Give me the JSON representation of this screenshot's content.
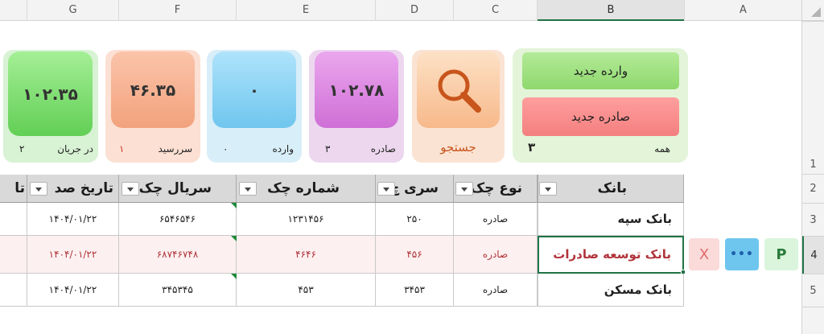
{
  "columns": [
    "G",
    "F",
    "E",
    "D",
    "C",
    "B",
    "A"
  ],
  "rows": [
    "1",
    "2",
    "3",
    "4",
    "5"
  ],
  "actions": {
    "new_incoming": "وارده جدید",
    "new_outgoing": "صادره جدید"
  },
  "all_card": {
    "label": "همه",
    "count": "۳"
  },
  "search_label": "جستجو",
  "tiles": [
    {
      "value": "۱۰۲.۷۸",
      "label": "صادره",
      "count": "۳"
    },
    {
      "value": "۰",
      "label": "وارده",
      "count": "۰"
    },
    {
      "value": "۴۶.۳۵",
      "label": "سررسید",
      "count": "۱"
    },
    {
      "value": "۱۰۲.۳۵",
      "label": "در جریان",
      "count": "۲"
    }
  ],
  "table": {
    "headers": [
      "بانک",
      "نوع چک",
      "سری چ",
      "شماره چک",
      "سریال چک",
      "تاریخ صد",
      "تا"
    ],
    "rows": [
      {
        "bank": "بانک سپه",
        "type": "صادره",
        "series": "۲۵۰",
        "number": "۱۲۳۱۴۵۶",
        "serial": "۶۵۴۶۵۴۶",
        "date": "۱۴۰۴/۰۱/۲۲"
      },
      {
        "bank": "بانک توسعه صادرات",
        "type": "صادره",
        "series": "۴۵۶",
        "number": "۴۶۴۶",
        "serial": "۶۸۷۴۶۷۴۸",
        "date": "۱۴۰۴/۰۱/۲۲"
      },
      {
        "bank": "بانک مسکن",
        "type": "صادره",
        "series": "۳۴۵۳",
        "number": "۴۵۳",
        "serial": "۳۴۵۳۴۵",
        "date": "۱۴۰۴/۰۱/۲۲"
      }
    ]
  },
  "row_buttons": {
    "print": "P",
    "more": "•••",
    "delete": "X"
  },
  "colors": {
    "accent": "#217346",
    "red_text": "#b0343a",
    "search_icon": "#c8551c"
  }
}
